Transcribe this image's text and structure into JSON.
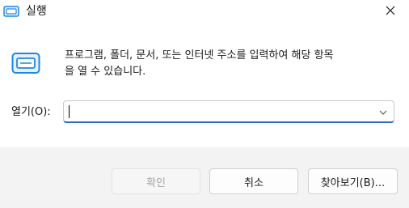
{
  "window": {
    "title": "실행",
    "title_icon": "run-icon",
    "close_icon": "close-icon"
  },
  "body": {
    "description": "프로그램, 폴더, 문서, 또는 인터넷 주소를 입력하여 해당 항목\n을 열 수 있습니다.",
    "big_icon": "run-icon",
    "open_label": "열기(O):",
    "open_value": "",
    "dropdown_icon": "chevron-down-icon"
  },
  "buttons": {
    "ok": "확인",
    "cancel": "취소",
    "browse": "찾아보기(B)..."
  },
  "colors": {
    "accent": "#2f6fbf",
    "icon_blue": "#1e88e5",
    "footer_bg": "#f3f3f3"
  }
}
